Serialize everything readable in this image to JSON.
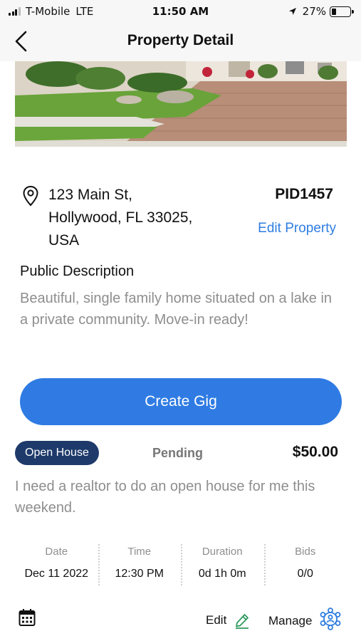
{
  "status_bar": {
    "carrier": "T-Mobile",
    "network": "LTE",
    "time": "11:50 AM",
    "battery": "27%",
    "battery_level": 0.27,
    "icons": [
      "signal-icon",
      "location-arrow-icon",
      "battery-icon"
    ]
  },
  "nav": {
    "title": "Property Detail",
    "back_icon": "chevron-left-icon"
  },
  "property": {
    "address_line1": "123 Main St,",
    "address_line2": "Hollywood, FL 33025,",
    "address_line3": "USA",
    "pid": "PID1457",
    "edit_label": "Edit Property",
    "location_icon": "map-pin-icon",
    "description_title": "Public Description",
    "description": "Beautiful, single family home situated on a lake in a private community. Move-in ready!"
  },
  "create_gig_label": "Create Gig",
  "gig": {
    "type": "Open House",
    "status": "Pending",
    "price": "$50.00",
    "description": "I need a realtor to do an open house for me this weekend.",
    "stats": [
      {
        "label": "Date",
        "value": "Dec 11 2022"
      },
      {
        "label": "Time",
        "value": "12:30 PM"
      },
      {
        "label": "Duration",
        "value": "0d 1h 0m"
      },
      {
        "label": "Bids",
        "value": "0/0"
      }
    ],
    "edit_label": "Edit",
    "manage_label": "Manage",
    "icons": [
      "calendar-icon",
      "pencil-icon",
      "manage-network-icon"
    ]
  },
  "colors": {
    "accent": "#2f7be3",
    "badge": "#1e3a6b",
    "link": "#2f7de1",
    "muted_text": "#8e8e8e",
    "edit_icon": "#2e9a5e",
    "manage_icon": "#2f7de1"
  }
}
